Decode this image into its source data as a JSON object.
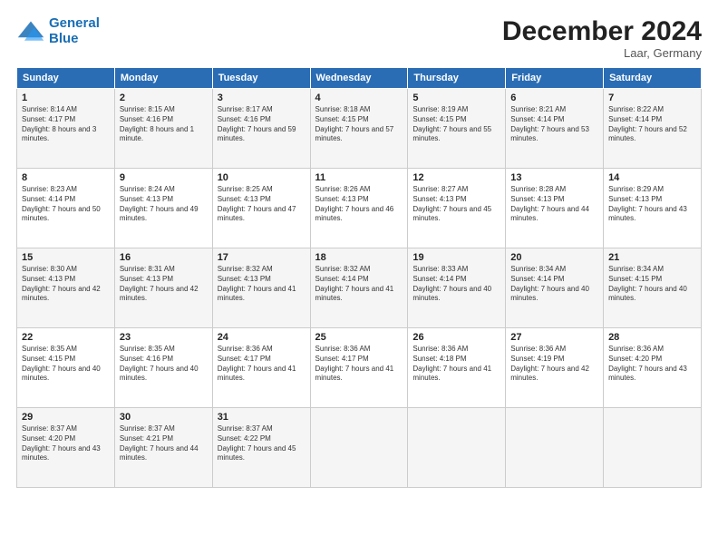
{
  "logo": {
    "line1": "General",
    "line2": "Blue"
  },
  "title": "December 2024",
  "location": "Laar, Germany",
  "days_header": [
    "Sunday",
    "Monday",
    "Tuesday",
    "Wednesday",
    "Thursday",
    "Friday",
    "Saturday"
  ],
  "weeks": [
    [
      {
        "day": "1",
        "sunrise": "8:14 AM",
        "sunset": "4:17 PM",
        "daylight": "8 hours and 3 minutes."
      },
      {
        "day": "2",
        "sunrise": "8:15 AM",
        "sunset": "4:16 PM",
        "daylight": "8 hours and 1 minute."
      },
      {
        "day": "3",
        "sunrise": "8:17 AM",
        "sunset": "4:16 PM",
        "daylight": "7 hours and 59 minutes."
      },
      {
        "day": "4",
        "sunrise": "8:18 AM",
        "sunset": "4:15 PM",
        "daylight": "7 hours and 57 minutes."
      },
      {
        "day": "5",
        "sunrise": "8:19 AM",
        "sunset": "4:15 PM",
        "daylight": "7 hours and 55 minutes."
      },
      {
        "day": "6",
        "sunrise": "8:21 AM",
        "sunset": "4:14 PM",
        "daylight": "7 hours and 53 minutes."
      },
      {
        "day": "7",
        "sunrise": "8:22 AM",
        "sunset": "4:14 PM",
        "daylight": "7 hours and 52 minutes."
      }
    ],
    [
      {
        "day": "8",
        "sunrise": "8:23 AM",
        "sunset": "4:14 PM",
        "daylight": "7 hours and 50 minutes."
      },
      {
        "day": "9",
        "sunrise": "8:24 AM",
        "sunset": "4:13 PM",
        "daylight": "7 hours and 49 minutes."
      },
      {
        "day": "10",
        "sunrise": "8:25 AM",
        "sunset": "4:13 PM",
        "daylight": "7 hours and 47 minutes."
      },
      {
        "day": "11",
        "sunrise": "8:26 AM",
        "sunset": "4:13 PM",
        "daylight": "7 hours and 46 minutes."
      },
      {
        "day": "12",
        "sunrise": "8:27 AM",
        "sunset": "4:13 PM",
        "daylight": "7 hours and 45 minutes."
      },
      {
        "day": "13",
        "sunrise": "8:28 AM",
        "sunset": "4:13 PM",
        "daylight": "7 hours and 44 minutes."
      },
      {
        "day": "14",
        "sunrise": "8:29 AM",
        "sunset": "4:13 PM",
        "daylight": "7 hours and 43 minutes."
      }
    ],
    [
      {
        "day": "15",
        "sunrise": "8:30 AM",
        "sunset": "4:13 PM",
        "daylight": "7 hours and 42 minutes."
      },
      {
        "day": "16",
        "sunrise": "8:31 AM",
        "sunset": "4:13 PM",
        "daylight": "7 hours and 42 minutes."
      },
      {
        "day": "17",
        "sunrise": "8:32 AM",
        "sunset": "4:13 PM",
        "daylight": "7 hours and 41 minutes."
      },
      {
        "day": "18",
        "sunrise": "8:32 AM",
        "sunset": "4:14 PM",
        "daylight": "7 hours and 41 minutes."
      },
      {
        "day": "19",
        "sunrise": "8:33 AM",
        "sunset": "4:14 PM",
        "daylight": "7 hours and 40 minutes."
      },
      {
        "day": "20",
        "sunrise": "8:34 AM",
        "sunset": "4:14 PM",
        "daylight": "7 hours and 40 minutes."
      },
      {
        "day": "21",
        "sunrise": "8:34 AM",
        "sunset": "4:15 PM",
        "daylight": "7 hours and 40 minutes."
      }
    ],
    [
      {
        "day": "22",
        "sunrise": "8:35 AM",
        "sunset": "4:15 PM",
        "daylight": "7 hours and 40 minutes."
      },
      {
        "day": "23",
        "sunrise": "8:35 AM",
        "sunset": "4:16 PM",
        "daylight": "7 hours and 40 minutes."
      },
      {
        "day": "24",
        "sunrise": "8:36 AM",
        "sunset": "4:17 PM",
        "daylight": "7 hours and 41 minutes."
      },
      {
        "day": "25",
        "sunrise": "8:36 AM",
        "sunset": "4:17 PM",
        "daylight": "7 hours and 41 minutes."
      },
      {
        "day": "26",
        "sunrise": "8:36 AM",
        "sunset": "4:18 PM",
        "daylight": "7 hours and 41 minutes."
      },
      {
        "day": "27",
        "sunrise": "8:36 AM",
        "sunset": "4:19 PM",
        "daylight": "7 hours and 42 minutes."
      },
      {
        "day": "28",
        "sunrise": "8:36 AM",
        "sunset": "4:20 PM",
        "daylight": "7 hours and 43 minutes."
      }
    ],
    [
      {
        "day": "29",
        "sunrise": "8:37 AM",
        "sunset": "4:20 PM",
        "daylight": "7 hours and 43 minutes."
      },
      {
        "day": "30",
        "sunrise": "8:37 AM",
        "sunset": "4:21 PM",
        "daylight": "7 hours and 44 minutes."
      },
      {
        "day": "31",
        "sunrise": "8:37 AM",
        "sunset": "4:22 PM",
        "daylight": "7 hours and 45 minutes."
      },
      null,
      null,
      null,
      null
    ]
  ]
}
